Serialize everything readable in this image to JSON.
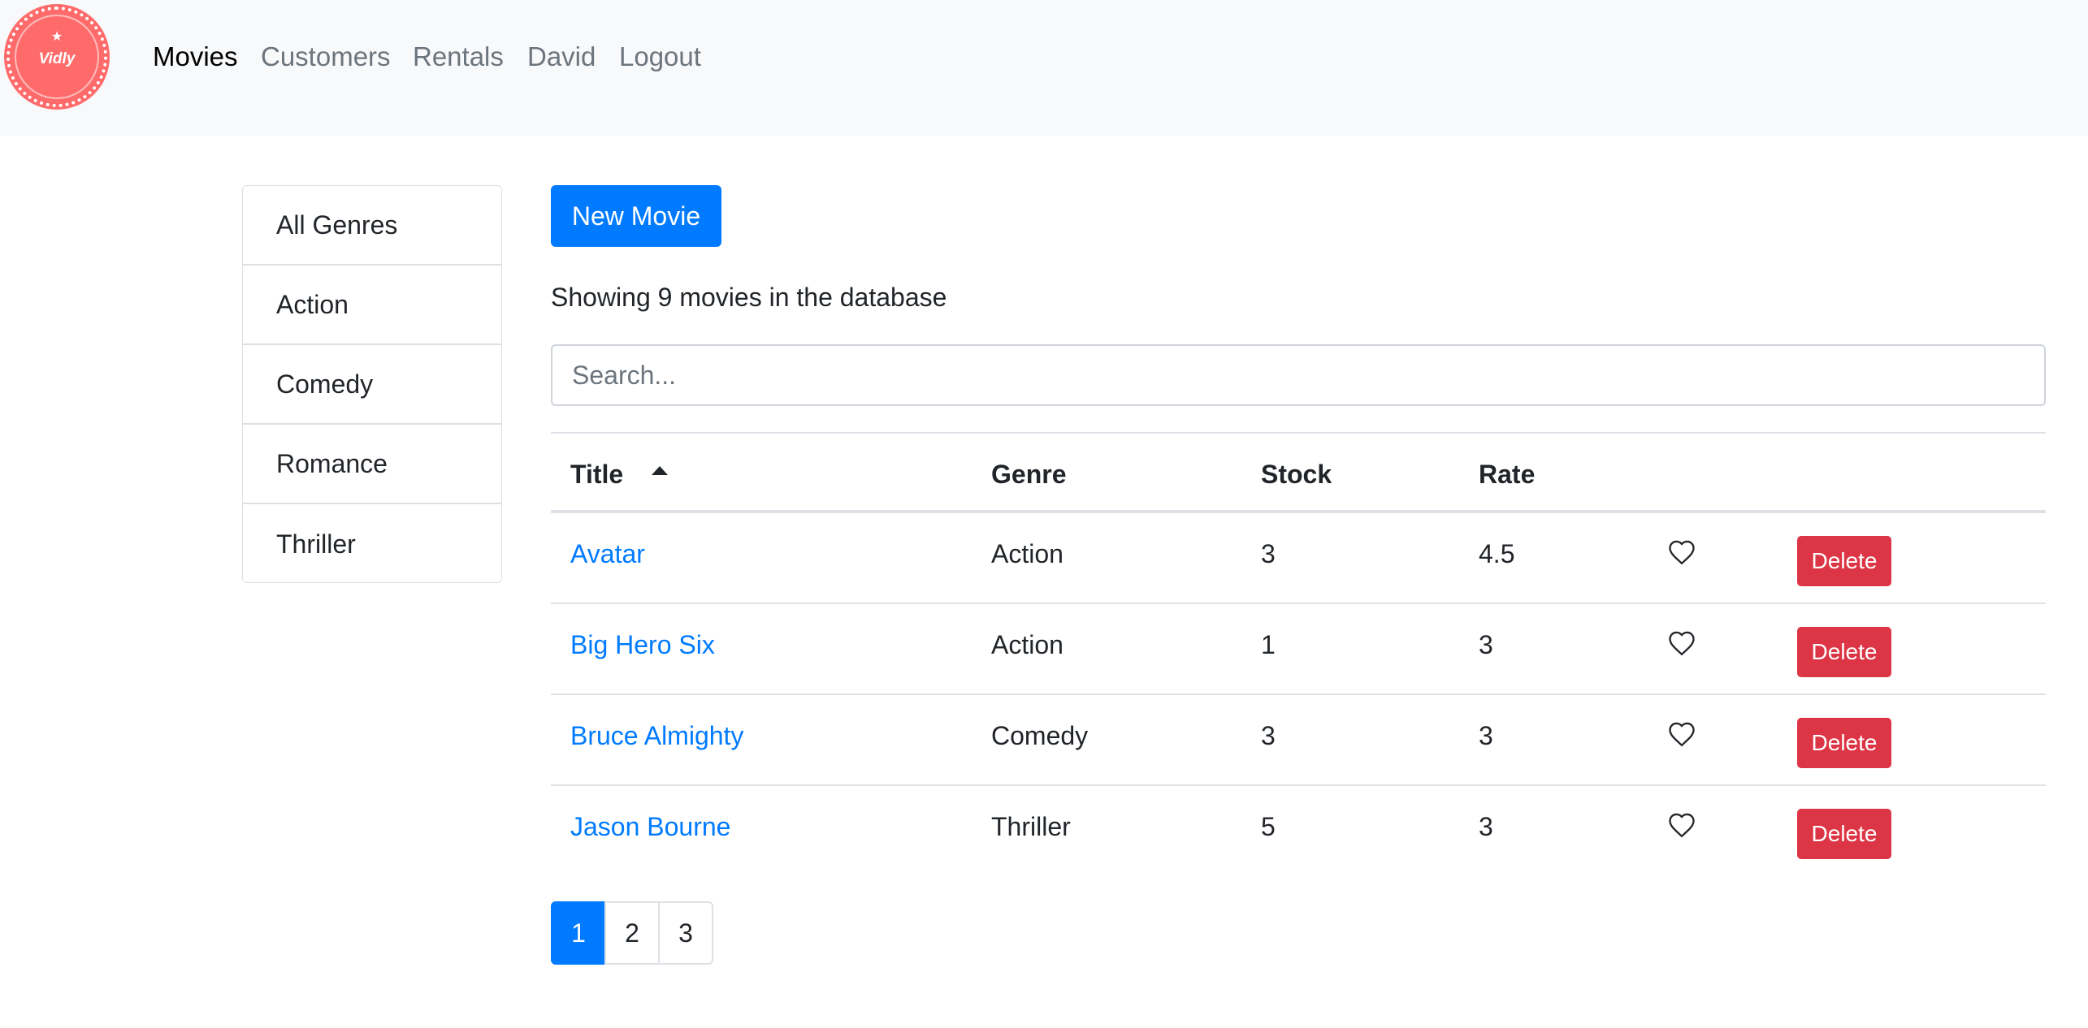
{
  "navbar": {
    "logo_text": "Vidly",
    "links": [
      "Movies",
      "Customers",
      "Rentals",
      "David",
      "Logout"
    ],
    "active": "Movies"
  },
  "genres": [
    "All Genres",
    "Action",
    "Comedy",
    "Romance",
    "Thriller"
  ],
  "main": {
    "new_movie_label": "New Movie",
    "count_text": "Showing 9 movies in the database",
    "search_placeholder": "Search..."
  },
  "table": {
    "columns": [
      "Title",
      "Genre",
      "Stock",
      "Rate"
    ],
    "sorted_by": "Title",
    "sort_order": "asc",
    "rows": [
      {
        "title": "Avatar",
        "genre": "Action",
        "stock": "3",
        "rate": "4.5",
        "liked": false,
        "delete_label": "Delete"
      },
      {
        "title": "Big Hero Six",
        "genre": "Action",
        "stock": "1",
        "rate": "3",
        "liked": false,
        "delete_label": "Delete"
      },
      {
        "title": "Bruce Almighty",
        "genre": "Comedy",
        "stock": "3",
        "rate": "3",
        "liked": false,
        "delete_label": "Delete"
      },
      {
        "title": "Jason Bourne",
        "genre": "Thriller",
        "stock": "5",
        "rate": "3",
        "liked": false,
        "delete_label": "Delete"
      }
    ]
  },
  "pagination": {
    "pages": [
      "1",
      "2",
      "3"
    ],
    "current": "1"
  },
  "colors": {
    "primary": "#007bff",
    "danger": "#dc3545",
    "logo": "#ff6b6b",
    "navbar_bg": "#f8f9fa"
  }
}
